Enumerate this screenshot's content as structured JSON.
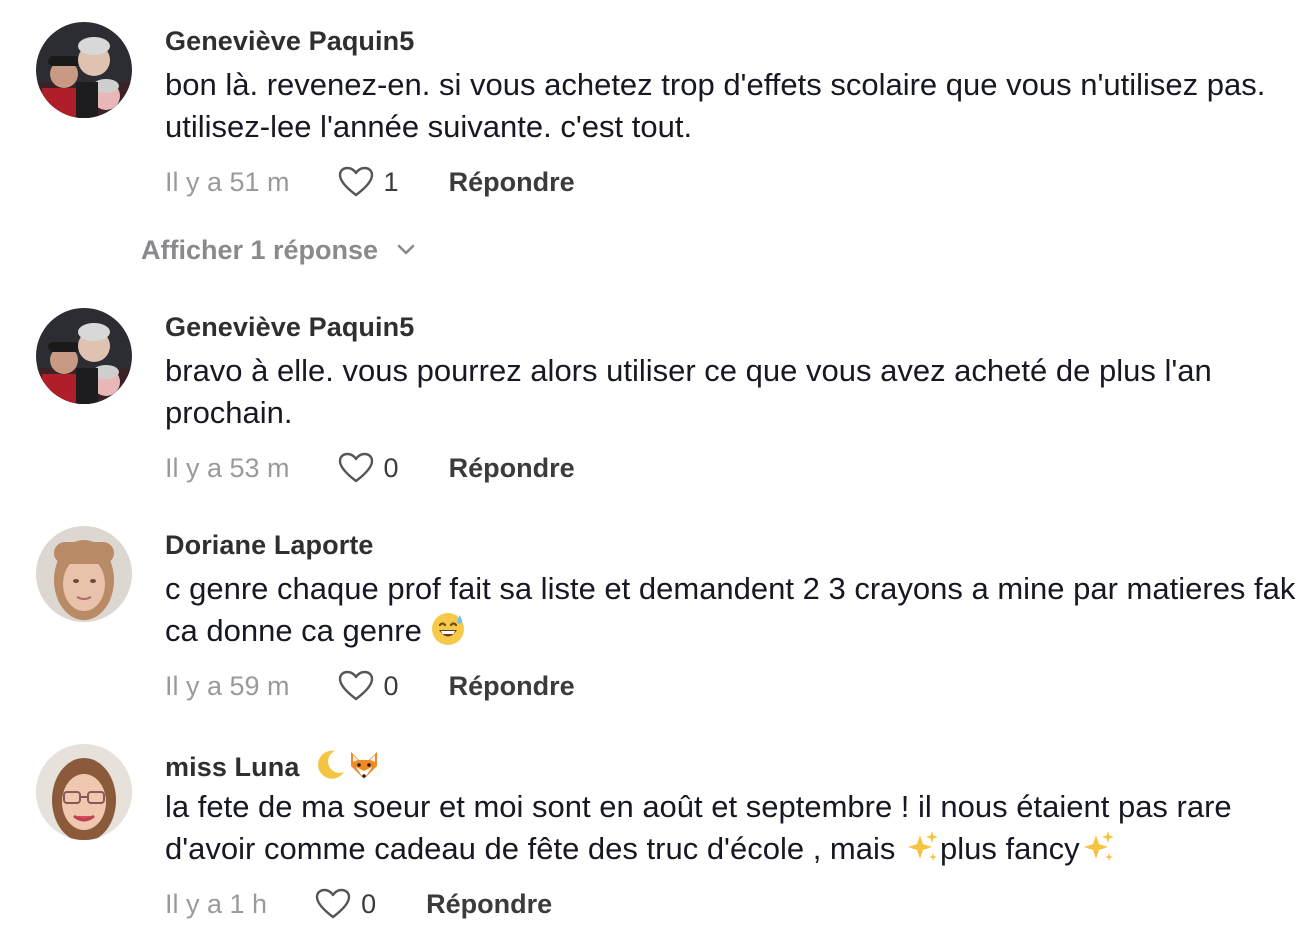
{
  "comments": [
    {
      "username": "Geneviève Paquin5",
      "text": "bon là. revenez-en. si vous achetez trop d'effets scolaire que vous n'utilisez pas. utilisez-lee l'année suivante. c'est tout.",
      "time": "Il y a 51 m",
      "likes": "1",
      "reply_label": "Répondre",
      "show_replies_label": "Afficher 1 réponse"
    },
    {
      "username": "Geneviève Paquin5",
      "text": "bravo à elle. vous pourrez alors utiliser ce que vous avez acheté de plus l'an prochain.",
      "time": "Il y a 53 m",
      "likes": "0",
      "reply_label": "Répondre"
    },
    {
      "username": "Doriane Laporte",
      "text_before_emoji": "c genre chaque prof fait sa liste et demandent 2 3 crayons a mine par matieres fak ca donne ca genre ",
      "emoji": "grinning-sweat-emoji",
      "time": "Il y a 59 m",
      "likes": "0",
      "reply_label": "Répondre"
    },
    {
      "username": "miss Luna",
      "username_emojis": [
        "crescent-moon-emoji",
        "fox-emoji"
      ],
      "text_part1": "la fete de ma soeur et moi sont en août et septembre ! il nous étaient pas rare d'avoir comme cadeau de fête des truc d'école , mais ",
      "text_part2": "plus fancy",
      "sparkles_emoji": "sparkles-emoji",
      "time": "Il y a 1 h",
      "likes": "0",
      "reply_label": "Répondre"
    }
  ],
  "colors": {
    "text": "#161823",
    "username": "#2f2f2f",
    "muted": "#9a9a9e",
    "show_replies": "#8a8a8e"
  }
}
